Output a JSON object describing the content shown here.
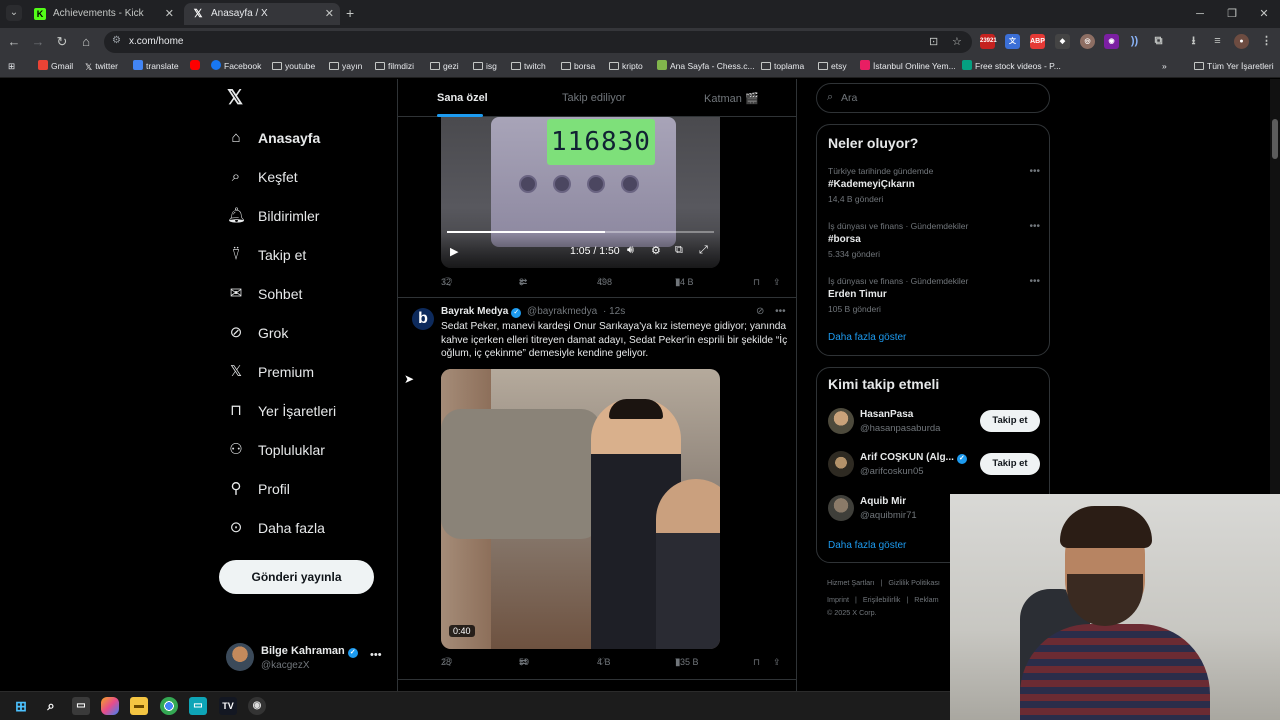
{
  "browser": {
    "tabs": [
      {
        "title": "Achievements - Kick Dashboard",
        "icon": "kick-icon"
      },
      {
        "title": "Anasayfa / X",
        "icon": "x-icon"
      }
    ],
    "url": "x.com/home",
    "ext_badge": "23921",
    "bookmarks": [
      "Gmail",
      "twitter",
      "translate",
      "Facebook",
      "youtube",
      "yayın",
      "filmdizi",
      "gezi",
      "isg",
      "twitch",
      "borsa",
      "kripto",
      "Ana Sayfa - Chess.c...",
      "toplama",
      "etsy",
      "İstanbul Online Yem...",
      "Free stock videos - P..."
    ],
    "all_bookmarks": "Tüm Yer İşaretleri"
  },
  "nav": {
    "items": [
      "Anasayfa",
      "Keşfet",
      "Bildirimler",
      "Takip et",
      "Sohbet",
      "Grok",
      "Premium",
      "Yer İşaretleri",
      "Topluluklar",
      "Profil",
      "Daha fazla"
    ],
    "post_button": "Gönderi yayınla",
    "account": {
      "name": "Bilge Kahraman",
      "handle": "@kacgezX"
    }
  },
  "feed": {
    "tabs": [
      "Sana özel",
      "Takip ediliyor",
      "Katman 🎬"
    ],
    "post1": {
      "video_time": "1:05 / 1:50",
      "video_progress": 0.59,
      "display_reading": "116830",
      "replies": "32",
      "reposts": "8",
      "likes": "498",
      "views": "74 B"
    },
    "post2": {
      "name": "Bayrak Medya",
      "handle": "@bayrakmedya",
      "time": "· 12s",
      "avatar_letter": "b",
      "text": "Sedat Peker, manevi kardeşi Onur Sarıkaya'ya kız istemeye gidiyor; yanında kahve içerken elleri titreyen damat adayı, Sedat Peker'in esprili bir şekilde “İç oğlum, iç çekinme” demesiyle kendine geliyor.",
      "video_duration": "0:40",
      "replies": "28",
      "reposts": "59",
      "likes": "4 B",
      "views": "735 B"
    }
  },
  "sidebar_right": {
    "search_placeholder": "Ara",
    "trends_title": "Neler oluyor?",
    "trends": [
      {
        "context": "Türkiye tarihinde gündemde",
        "title": "#KademeyiÇıkarın",
        "count": "14,4 B gönderi"
      },
      {
        "context": "İş dünyası ve finans · Gündemdekiler",
        "title": "#borsa",
        "count": "5.334 gönderi"
      },
      {
        "context": "İş dünyası ve finans · Gündemdekiler",
        "title": "Erden Timur",
        "count": "105 B gönderi"
      }
    ],
    "show_more": "Daha fazla göster",
    "who_title": "Kimi takip etmeli",
    "who": [
      {
        "name": "HasanPasa",
        "handle": "@hasanpasaburda",
        "follow": "Takip et"
      },
      {
        "name": "Arif COŞKUN (Alg...",
        "handle": "@arifcoskun05",
        "follow": "Takip et"
      },
      {
        "name": "Aquib Mir",
        "handle": "@aquibmir71",
        "follow": ""
      }
    ],
    "footer": {
      "row1": [
        "Hizmet Şartları",
        "|",
        "Gizlilik Politikası"
      ],
      "row2": [
        "Imprint",
        "|",
        "Erişilebilirlik",
        "|",
        "Reklam"
      ],
      "copyright": "© 2025 X Corp."
    }
  },
  "colors": {
    "accent": "#1d9bf0",
    "background": "#000000",
    "kick_green": "#53fc18"
  }
}
